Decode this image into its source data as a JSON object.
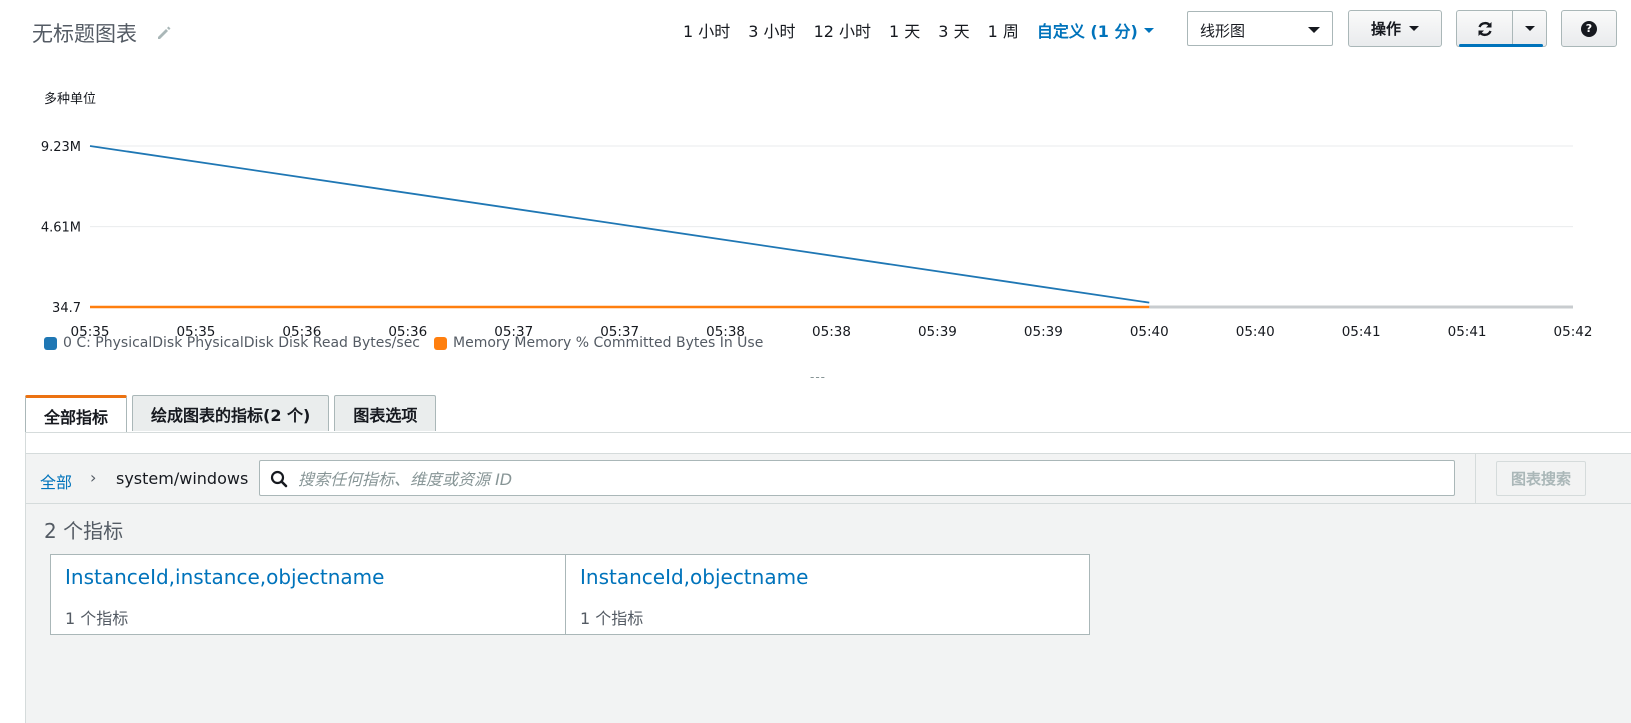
{
  "header": {
    "title": "无标题图表",
    "time_ranges": [
      "1 小时",
      "3 小时",
      "12 小时",
      "1 天",
      "3 天",
      "1 周"
    ],
    "custom_range": "自定义 (1 分)",
    "chart_type": "线形图",
    "actions_label": "操作",
    "help_label": "?"
  },
  "chart_data": {
    "type": "line",
    "ylabel": "多种单位",
    "y_ticks": [
      "9.23M",
      "4.61M",
      "34.7"
    ],
    "y_tick_values": [
      9230000,
      4610000,
      34.7
    ],
    "ylim": [
      34.7,
      9230000
    ],
    "x_ticks": [
      "05:35",
      "05:35",
      "05:36",
      "05:36",
      "05:37",
      "05:37",
      "05:38",
      "05:38",
      "05:39",
      "05:39",
      "05:40",
      "05:40",
      "05:41",
      "05:41",
      "05:42"
    ],
    "x_range_minutes": [
      0,
      7
    ],
    "grid": true,
    "legend_position": "bottom-left",
    "series": [
      {
        "name": "0 C: PhysicalDisk PhysicalDisk Disk Read Bytes/sec",
        "color": "#1f77b4",
        "x": [
          0,
          5
        ],
        "y": [
          9230000,
          250000
        ]
      },
      {
        "name": "Memory Memory % Committed Bytes In Use",
        "color": "#ff7f0e",
        "x": [
          0,
          5
        ],
        "y": [
          34.7,
          34.7
        ]
      }
    ]
  },
  "splitter": "---",
  "tabs": [
    "全部指标",
    "绘成图表的指标(2 个)",
    "图表选项"
  ],
  "browser": {
    "breadcrumb_root": "全部",
    "breadcrumb_sep": "›",
    "breadcrumb_current": "system/windows",
    "search_placeholder": "搜索任何指标、维度或资源 ID",
    "graph_search_label": "图表搜索",
    "metric_count": "2 个指标",
    "cards": [
      {
        "title": "InstanceId,instance,objectname",
        "subtitle": "1 个指标"
      },
      {
        "title": "InstanceId,objectname",
        "subtitle": "1 个指标"
      }
    ]
  }
}
